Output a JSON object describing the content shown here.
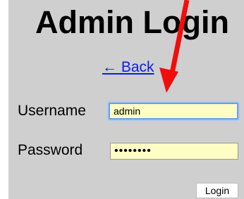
{
  "page": {
    "title": "Admin Login"
  },
  "nav": {
    "back_label": "← Back"
  },
  "form": {
    "username_label": "Username",
    "username_value": "admin",
    "password_label": "Password",
    "password_value": "••••••••",
    "login_label": "Login"
  },
  "colors": {
    "panel_background": "#cfcfcf",
    "input_background": "#fdfdc4",
    "link": "#0b1ee6",
    "focus_ring": "#6a9ee8",
    "annotation_arrow": "#ff0000"
  },
  "annotation": {
    "icon": "arrow-icon"
  }
}
